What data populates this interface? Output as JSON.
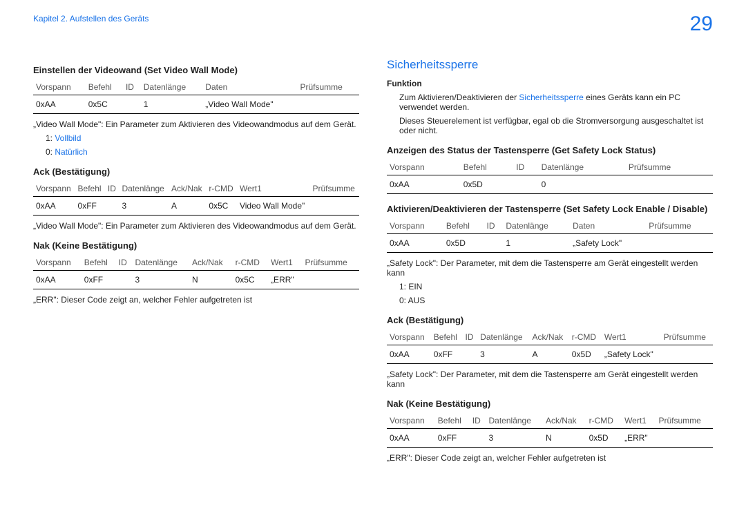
{
  "chapter": "Kapitel 2. Aufstellen des Geräts",
  "page_number": "29",
  "left": {
    "h1": "Einstellen der Videowand (Set Video Wall Mode)",
    "t1": {
      "h": [
        "Vorspann",
        "Befehl",
        "ID",
        "Datenlänge",
        "Daten",
        "Prüfsumme"
      ],
      "r": [
        "0xAA",
        "0x5C",
        "",
        "1",
        "„Video Wall Mode\"",
        ""
      ]
    },
    "note1": "„Video Wall Mode\": Ein Parameter zum Aktivieren des Videowandmodus auf dem Gerät.",
    "opt1_key": "1: ",
    "opt1_val": "Vollbild",
    "opt0_key": "0: ",
    "opt0_val": "Natürlich",
    "h2": "Ack (Bestätigung)",
    "t2": {
      "h": [
        "Vorspann",
        "Befehl",
        "ID",
        "Datenlänge",
        "Ack/Nak",
        "r-CMD",
        "Wert1",
        "Prüfsumme"
      ],
      "r": [
        "0xAA",
        "0xFF",
        "",
        "3",
        "A",
        "0x5C",
        "Video Wall Mode\"",
        ""
      ]
    },
    "note2": "„Video Wall Mode\": Ein Parameter zum Aktivieren des Videowandmodus auf dem Gerät.",
    "h3": "Nak (Keine Bestätigung)",
    "t3": {
      "h": [
        "Vorspann",
        "Befehl",
        "ID",
        "Datenlänge",
        "Ack/Nak",
        "r-CMD",
        "Wert1",
        "Prüfsumme"
      ],
      "r": [
        "0xAA",
        "0xFF",
        "",
        "3",
        "N",
        "0x5C",
        "„ERR\"",
        ""
      ]
    },
    "note3": "„ERR\": Dieser Code zeigt an, welcher Fehler aufgetreten ist"
  },
  "right": {
    "title": "Sicherheitssperre",
    "func_h": "Funktion",
    "func_p1a": "Zum Aktivieren/Deaktivieren der",
    "func_p1b": "Sicherheitssperre",
    "func_p1c": " eines Geräts kann ein PC verwendet werden.",
    "func_p2": "Dieses Steuerelement ist verfügbar, egal ob die Stromversorgung ausgeschaltet ist oder nicht.",
    "h1": "Anzeigen des Status der Tastensperre (Get Safety Lock Status)",
    "t1": {
      "h": [
        "Vorspann",
        "Befehl",
        "ID",
        "Datenlänge",
        "Prüfsumme"
      ],
      "r": [
        "0xAA",
        "0x5D",
        "",
        "0",
        ""
      ]
    },
    "h2": "Aktivieren/Deaktivieren der Tastensperre (Set Safety Lock Enable / Disable)",
    "t2": {
      "h": [
        "Vorspann",
        "Befehl",
        "ID",
        "Datenlänge",
        "Daten",
        "Prüfsumme"
      ],
      "r": [
        "0xAA",
        "0x5D",
        "",
        "1",
        "„Safety Lock\"",
        ""
      ]
    },
    "note1": "„Safety Lock\": Der Parameter, mit dem die Tastensperre am Gerät eingestellt werden kann",
    "opt1": "1: EIN",
    "opt0": "0: AUS",
    "h3": "Ack (Bestätigung)",
    "t3": {
      "h": [
        "Vorspann",
        "Befehl",
        "ID",
        "Datenlänge",
        "Ack/Nak",
        "r-CMD",
        "Wert1",
        "Prüfsumme"
      ],
      "r": [
        "0xAA",
        "0xFF",
        "",
        "3",
        "A",
        "0x5D",
        "„Safety Lock\"",
        ""
      ]
    },
    "note2": "„Safety Lock\": Der Parameter, mit dem die Tastensperre am Gerät eingestellt werden kann",
    "h4": "Nak (Keine Bestätigung)",
    "t4": {
      "h": [
        "Vorspann",
        "Befehl",
        "ID",
        "Datenlänge",
        "Ack/Nak",
        "r-CMD",
        "Wert1",
        "Prüfsumme"
      ],
      "r": [
        "0xAA",
        "0xFF",
        "",
        "3",
        "N",
        "0x5D",
        "„ERR\"",
        ""
      ]
    },
    "note3": "„ERR\": Dieser Code zeigt an, welcher Fehler aufgetreten ist"
  }
}
